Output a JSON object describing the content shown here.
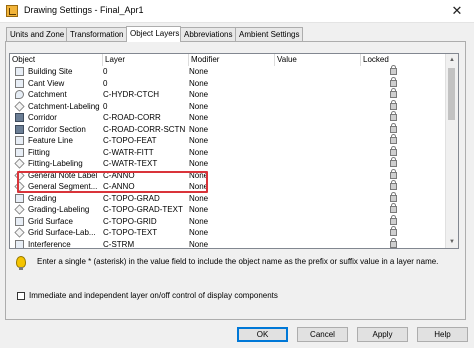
{
  "window": {
    "title": "Drawing Settings - Final_Apr1",
    "close_glyph": "✕"
  },
  "tabs": [
    {
      "label": "Units and Zone",
      "active": false
    },
    {
      "label": "Transformation",
      "active": false
    },
    {
      "label": "Object Layers",
      "active": true
    },
    {
      "label": "Abbreviations",
      "active": false
    },
    {
      "label": "Ambient Settings",
      "active": false
    }
  ],
  "grid": {
    "columns": [
      "Object",
      "Layer",
      "Modifier",
      "Value",
      "Locked"
    ],
    "rows": [
      {
        "object": "Building Site",
        "layer": "0",
        "modifier": "None",
        "icon": "building-site-icon"
      },
      {
        "object": "Cant View",
        "layer": "0",
        "modifier": "None",
        "icon": "cant-view-icon"
      },
      {
        "object": "Catchment",
        "layer": "C-HYDR-CTCH",
        "modifier": "None",
        "icon": "catchment-icon"
      },
      {
        "object": "Catchment-Labeling",
        "layer": "0",
        "modifier": "None",
        "icon": "catchment-labeling-icon"
      },
      {
        "object": "Corridor",
        "layer": "C-ROAD-CORR",
        "modifier": "None",
        "icon": "corridor-icon"
      },
      {
        "object": "Corridor Section",
        "layer": "C-ROAD-CORR-SCTN",
        "modifier": "None",
        "icon": "corridor-section-icon"
      },
      {
        "object": "Feature Line",
        "layer": "C-TOPO-FEAT",
        "modifier": "None",
        "icon": "feature-line-icon"
      },
      {
        "object": "Fitting",
        "layer": "C-WATR-FITT",
        "modifier": "None",
        "icon": "fitting-icon"
      },
      {
        "object": "Fitting-Labeling",
        "layer": "C-WATR-TEXT",
        "modifier": "None",
        "icon": "fitting-labeling-icon"
      },
      {
        "object": "General Note Label",
        "layer": "C-ANNO",
        "modifier": "None",
        "icon": "general-note-label-icon"
      },
      {
        "object": "General Segment...",
        "layer": "C-ANNO",
        "modifier": "None",
        "icon": "general-segment-label-icon"
      },
      {
        "object": "Grading",
        "layer": "C-TOPO-GRAD",
        "modifier": "None",
        "icon": "grading-icon"
      },
      {
        "object": "Grading-Labeling",
        "layer": "C-TOPO-GRAD-TEXT",
        "modifier": "None",
        "icon": "grading-labeling-icon"
      },
      {
        "object": "Grid Surface",
        "layer": "C-TOPO-GRID",
        "modifier": "None",
        "icon": "grid-surface-icon"
      },
      {
        "object": "Grid Surface-Lab...",
        "layer": "C-TOPO-TEXT",
        "modifier": "None",
        "icon": "grid-surface-labeling-icon"
      },
      {
        "object": "Interference",
        "layer": "C-STRM",
        "modifier": "None",
        "icon": "interference-icon"
      }
    ]
  },
  "hint": "Enter a single * (asterisk) in the value field to include the object name as the prefix or suffix value in a layer name.",
  "checkbox": {
    "label": "Immediate and independent layer on/off control of display components",
    "checked": false
  },
  "buttons": {
    "ok": "OK",
    "cancel": "Cancel",
    "apply": "Apply",
    "help": "Help"
  },
  "colors": {
    "highlight": "#d9343a",
    "default_button_border": "#0078d7"
  }
}
